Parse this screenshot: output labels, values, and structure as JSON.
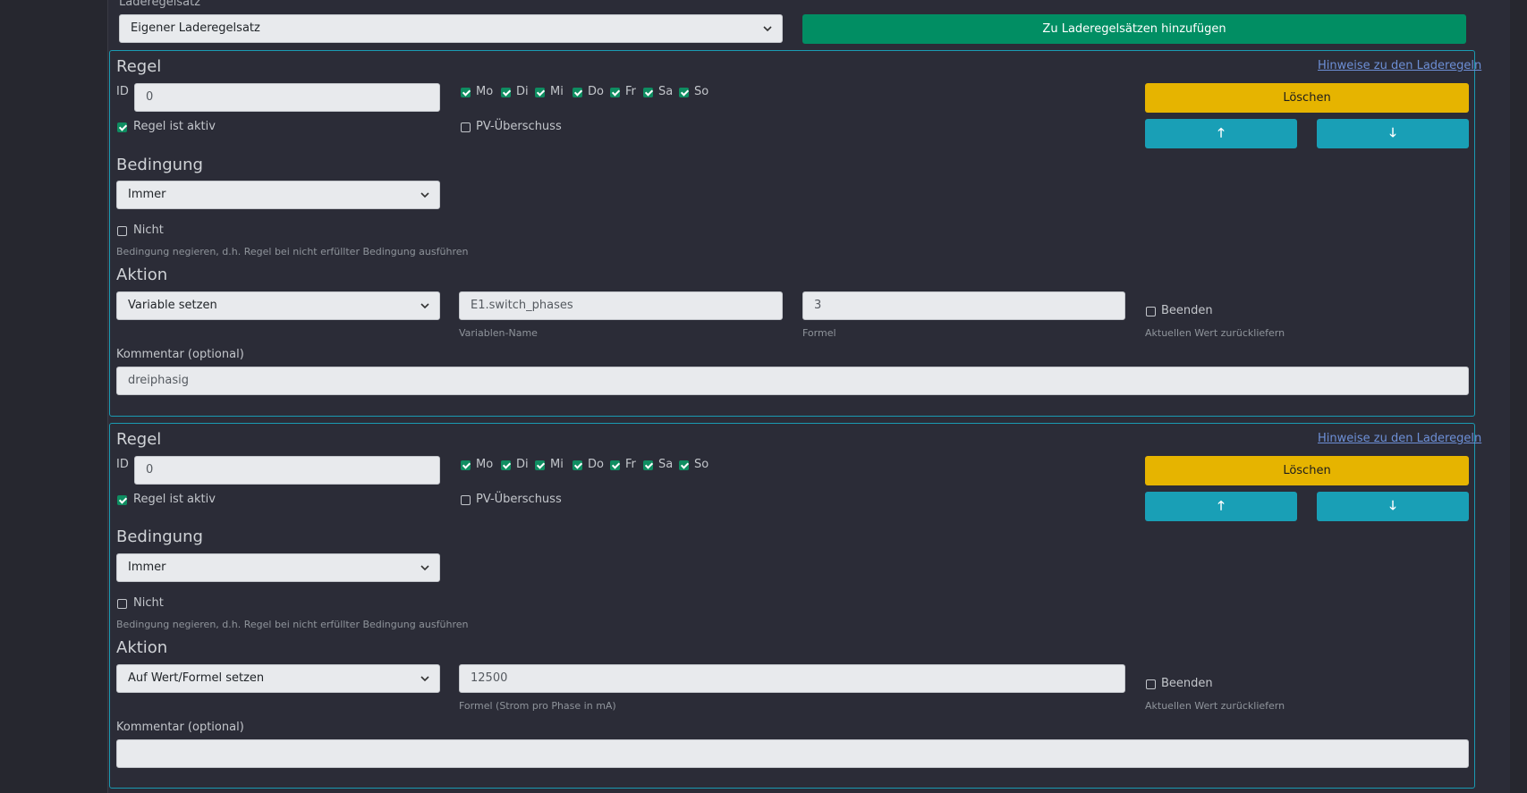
{
  "top": {
    "set_label": "Laderegelsatz",
    "set_value": "Eigener Laderegelsatz",
    "add_button": "Zu Laderegelsätzen hinzufügen"
  },
  "rules": [
    {
      "title": "Regel",
      "hint_link": "Hinweise zu den Laderegeln",
      "id_label": "ID",
      "id_value": "0",
      "active_label": "Regel ist aktiv",
      "pv_label": "PV-Überschuss",
      "days": [
        "Mo",
        "Di",
        "Mi",
        "Do",
        "Fr",
        "Sa",
        "So"
      ],
      "delete_label": "Löschen",
      "up_label": "🡑",
      "down_label": "🡓",
      "cond_title": "Bedingung",
      "cond_value": "Immer",
      "not_label": "Nicht",
      "not_help": "Bedingung negieren, d.h. Regel bei nicht erfüllter Bedingung ausführen",
      "action_title": "Aktion",
      "action_value": "Variable setzen",
      "var_name_value": "E1.switch_phases",
      "var_name_label": "Variablen-Name",
      "formula_value": "3",
      "formula_label": "Formel",
      "finish_label": "Beenden",
      "finish_help": "Aktuellen Wert zurückliefern",
      "comment_label": "Kommentar (optional)",
      "comment_value": "dreiphasig"
    },
    {
      "title": "Regel",
      "hint_link": "Hinweise zu den Laderegeln",
      "id_label": "ID",
      "id_value": "0",
      "active_label": "Regel ist aktiv",
      "pv_label": "PV-Überschuss",
      "days": [
        "Mo",
        "Di",
        "Mi",
        "Do",
        "Fr",
        "Sa",
        "So"
      ],
      "delete_label": "Löschen",
      "up_label": "🡑",
      "down_label": "🡓",
      "cond_title": "Bedingung",
      "cond_value": "Immer",
      "not_label": "Nicht",
      "not_help": "Bedingung negieren, d.h. Regel bei nicht erfüllter Bedingung ausführen",
      "action_title": "Aktion",
      "action_value": "Auf Wert/Formel setzen",
      "formula_value": "12500",
      "formula_label": "Formel (Strom pro Phase in mA)",
      "finish_label": "Beenden",
      "finish_help": "Aktuellen Wert zurückliefern",
      "comment_label": "Kommentar (optional)",
      "comment_value": ""
    }
  ],
  "colors": {
    "green": "#018e63",
    "yellow": "#e6b400",
    "teal": "#199fb6",
    "border": "#1a9bb2"
  }
}
